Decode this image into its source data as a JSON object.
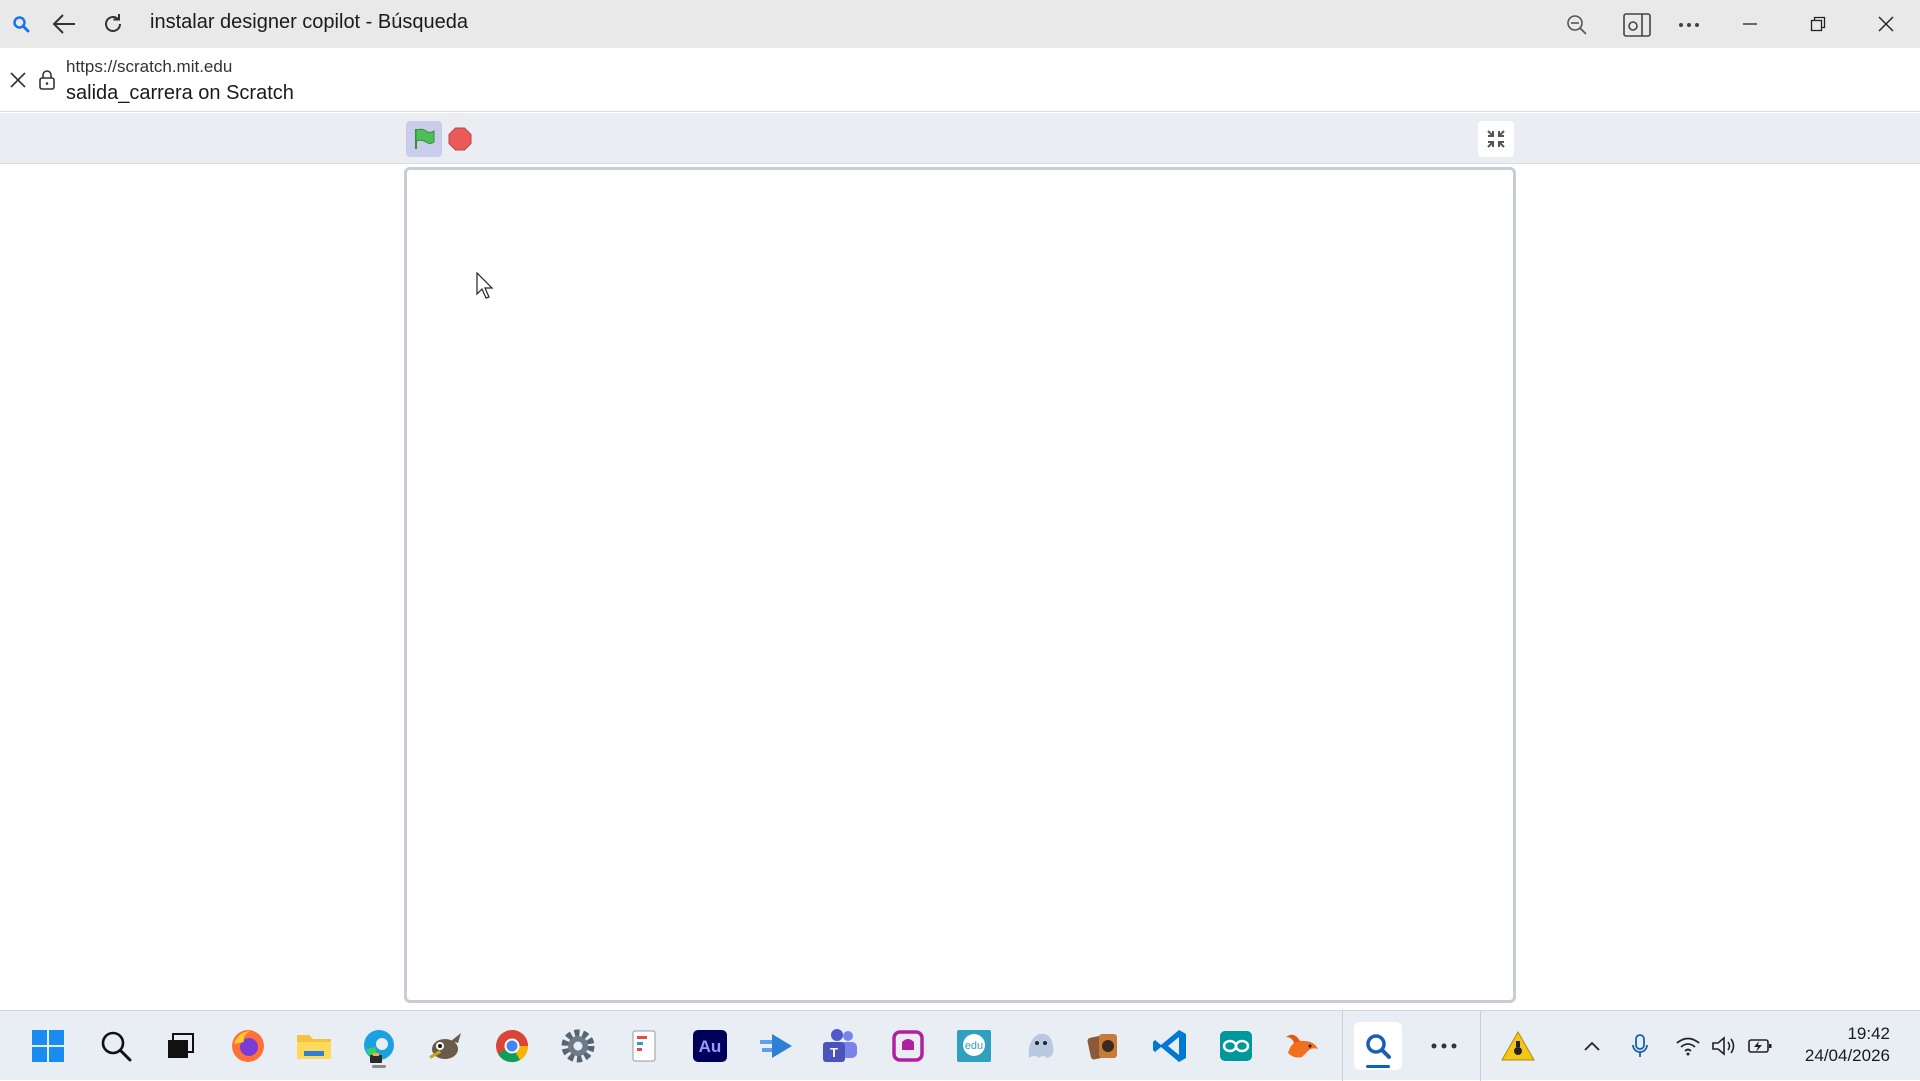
{
  "window": {
    "title": "instalar designer copilot - Búsqueda"
  },
  "address": {
    "url": "https://scratch.mit.edu",
    "page_title": "salida_carrera on Scratch"
  },
  "icons": {
    "search": "search-icon",
    "back": "back-arrow-icon",
    "refresh": "refresh-icon",
    "zoom": "zoom-out-icon",
    "reader": "reader-view-icon",
    "more": "more-icon",
    "minimize": "minimize-icon",
    "restore": "restore-icon",
    "close": "close-icon",
    "green_flag": "green-flag-icon",
    "stop": "stop-icon",
    "exit_fullscreen": "exit-fullscreen-icon"
  },
  "colors": {
    "flag_green": "#4cbf56",
    "stop_red": "#ec5959",
    "accent": "#0067c0"
  },
  "taskbar": {
    "apps": [
      "start",
      "search",
      "task-view",
      "firefox",
      "file-explorer",
      "edge",
      "gimp",
      "chrome",
      "settings",
      "notepad",
      "audition",
      "power-automate",
      "teams",
      "app-store",
      "edu",
      "peregrine",
      "music",
      "vscode",
      "arduino",
      "scratch",
      "search-app",
      "more"
    ],
    "clock_time": "19:42",
    "clock_date": "24/04/2026"
  }
}
